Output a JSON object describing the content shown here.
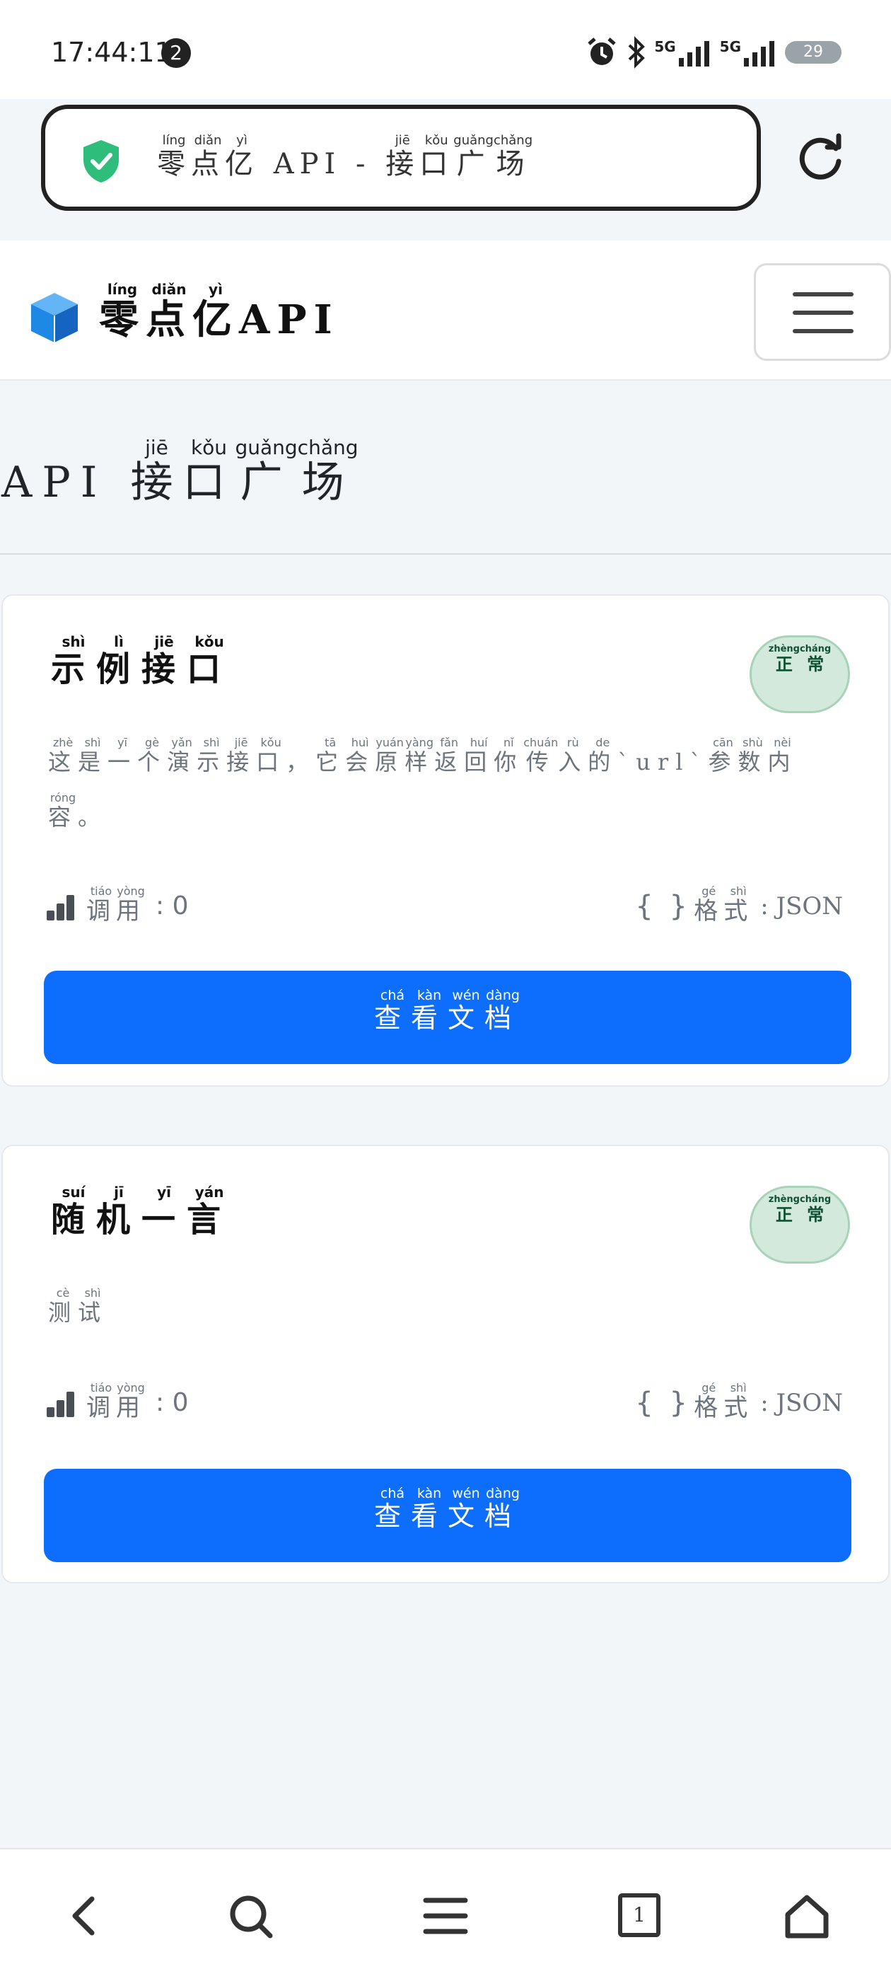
{
  "status_bar": {
    "time": "17:44:11",
    "notification_count": "2",
    "network_1": "5G",
    "network_2": "5G",
    "battery": "29"
  },
  "browser": {
    "url_title": {
      "chars": [
        {
          "c": "零",
          "p": "líng"
        },
        {
          "c": "点",
          "p": "diǎn"
        },
        {
          "c": "亿",
          "p": "yì"
        },
        {
          "c": " API - ",
          "p": ""
        },
        {
          "c": "接",
          "p": "jiē"
        },
        {
          "c": "口",
          "p": "kǒu"
        },
        {
          "c": "广",
          "p": "guǎng"
        },
        {
          "c": "场",
          "p": "chǎng"
        }
      ]
    }
  },
  "header": {
    "brand": {
      "chars": [
        {
          "c": "零",
          "p": "líng"
        },
        {
          "c": "点",
          "p": "diǎn"
        },
        {
          "c": "亿",
          "p": "yì"
        },
        {
          "c": "API",
          "p": ""
        }
      ]
    }
  },
  "page": {
    "title": {
      "chars": [
        {
          "c": "API ",
          "p": ""
        },
        {
          "c": "接",
          "p": "jiē"
        },
        {
          "c": "口",
          "p": "kǒu"
        },
        {
          "c": "广",
          "p": "guǎng"
        },
        {
          "c": "场",
          "p": "chǎng"
        }
      ]
    }
  },
  "cards": [
    {
      "title": [
        {
          "c": "示",
          "p": "shì"
        },
        {
          "c": "例",
          "p": "lì"
        },
        {
          "c": "接",
          "p": "jiē"
        },
        {
          "c": "口",
          "p": "kǒu"
        }
      ],
      "status": [
        {
          "c": "正",
          "p": "zhèng"
        },
        {
          "c": "常",
          "p": "cháng"
        }
      ],
      "description": [
        {
          "c": "这",
          "p": "zhè"
        },
        {
          "c": "是",
          "p": "shì"
        },
        {
          "c": "一",
          "p": "yī"
        },
        {
          "c": "个",
          "p": "gè"
        },
        {
          "c": "演",
          "p": "yǎn"
        },
        {
          "c": "示",
          "p": "shì"
        },
        {
          "c": "接",
          "p": "jiē"
        },
        {
          "c": "口",
          "p": "kǒu"
        },
        {
          "c": "，",
          "p": ""
        },
        {
          "c": "它",
          "p": "tā"
        },
        {
          "c": "会",
          "p": "huì"
        },
        {
          "c": "原",
          "p": "yuán"
        },
        {
          "c": "样",
          "p": "yàng"
        },
        {
          "c": "返",
          "p": "fǎn"
        },
        {
          "c": "回",
          "p": "huí"
        },
        {
          "c": "你",
          "p": "nǐ"
        },
        {
          "c": "传",
          "p": "chuán"
        },
        {
          "c": "入",
          "p": "rù"
        },
        {
          "c": "的",
          "p": "de"
        },
        {
          "c": "`url`",
          "p": ""
        },
        {
          "c": "参",
          "p": "cān"
        },
        {
          "c": "数",
          "p": "shù"
        },
        {
          "c": "内",
          "p": "nèi"
        },
        {
          "c": "容",
          "p": "róng"
        },
        {
          "c": "。",
          "p": ""
        }
      ],
      "calls_label": [
        {
          "c": "调",
          "p": "tiáo"
        },
        {
          "c": "用",
          "p": "yòng"
        }
      ],
      "calls_value": ": 0",
      "format_label": [
        {
          "c": "格",
          "p": "gé"
        },
        {
          "c": "式",
          "p": "shì"
        }
      ],
      "format_value": ": JSON",
      "button": [
        {
          "c": "查",
          "p": "chá"
        },
        {
          "c": "看",
          "p": "kàn"
        },
        {
          "c": "文",
          "p": "wén"
        },
        {
          "c": "档",
          "p": "dàng"
        }
      ]
    },
    {
      "title": [
        {
          "c": "随",
          "p": "suí"
        },
        {
          "c": "机",
          "p": "jī"
        },
        {
          "c": "一",
          "p": "yī"
        },
        {
          "c": "言",
          "p": "yán"
        }
      ],
      "status": [
        {
          "c": "正",
          "p": "zhèng"
        },
        {
          "c": "常",
          "p": "cháng"
        }
      ],
      "description": [
        {
          "c": "测",
          "p": "cè"
        },
        {
          "c": "试",
          "p": "shì"
        }
      ],
      "calls_label": [
        {
          "c": "调",
          "p": "tiáo"
        },
        {
          "c": "用",
          "p": "yòng"
        }
      ],
      "calls_value": ": 0",
      "format_label": [
        {
          "c": "格",
          "p": "gé"
        },
        {
          "c": "式",
          "p": "shì"
        }
      ],
      "format_value": ": JSON",
      "button": [
        {
          "c": "查",
          "p": "chá"
        },
        {
          "c": "看",
          "p": "kàn"
        },
        {
          "c": "文",
          "p": "wén"
        },
        {
          "c": "档",
          "p": "dàng"
        }
      ]
    }
  ],
  "bottom_nav": {
    "tab_count": "1",
    "items": [
      "back-icon",
      "search-icon",
      "menu-icon",
      "tabs-icon",
      "home-icon"
    ]
  },
  "colors": {
    "primary": "#0d6efd",
    "success_bg": "#d3e9dc",
    "shield": "#2ebd7a",
    "brand_cube": "#1e88e5"
  }
}
